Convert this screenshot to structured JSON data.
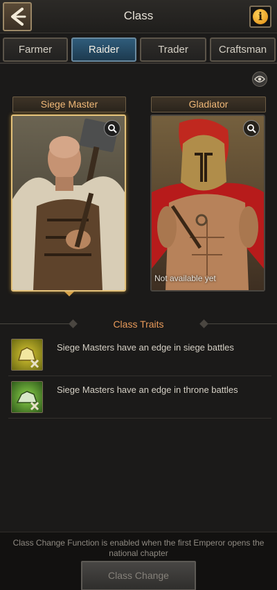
{
  "header": {
    "title": "Class",
    "back_icon": "back-arrow-icon",
    "info_icon": "info-icon",
    "info_glyph": "i"
  },
  "tabs": [
    {
      "label": "Farmer",
      "active": false
    },
    {
      "label": "Raider",
      "active": true
    },
    {
      "label": "Trader",
      "active": false
    },
    {
      "label": "Craftsman",
      "active": false
    }
  ],
  "classes": [
    {
      "title": "Siege Master",
      "selected": true,
      "locked_text": ""
    },
    {
      "title": "Gladiator",
      "selected": false,
      "locked_text": "Not available yet"
    }
  ],
  "traits": {
    "heading": "Class Traits",
    "items": [
      {
        "text": "Siege Masters have an edge in siege battles",
        "icon": "siege-trait-icon"
      },
      {
        "text": "Siege Masters have an edge in throne battles",
        "icon": "throne-trait-icon"
      }
    ]
  },
  "footer": {
    "notice": "Class Change Function is enabled when the first Emperor opens the national chapter",
    "button_label": "Class Change"
  },
  "colors": {
    "accent_orange": "#e89a5a",
    "active_tab": "#2f5c7a",
    "selected_border": "#e4c27a"
  }
}
